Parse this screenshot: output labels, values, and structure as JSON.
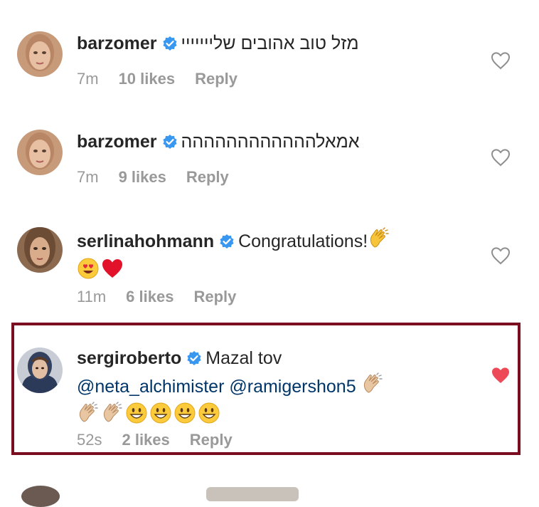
{
  "comments": [
    {
      "username": "barzomer",
      "verified": true,
      "text": "מזל טוב אהובים שלייייייי",
      "time": "7m",
      "likes": "10 likes",
      "reply": "Reply",
      "liked": false
    },
    {
      "username": "barzomer",
      "verified": true,
      "text": "אמאלהההההההההההה",
      "time": "7m",
      "likes": "9 likes",
      "reply": "Reply",
      "liked": false
    },
    {
      "username": "serlinahohmann",
      "verified": true,
      "text": "Congratulations!",
      "emojis": [
        "clapping-hands",
        "heart-eyes-face",
        "red-heart"
      ],
      "time": "11m",
      "likes": "6 likes",
      "reply": "Reply",
      "liked": false
    },
    {
      "username": "sergiroberto",
      "verified": true,
      "text": "Mazal tov",
      "mentions": [
        "@neta_alchimister",
        "@ramigershon5"
      ],
      "emojis": [
        "clapping-hands",
        "clapping-hands",
        "clapping-hands",
        "grinning-face",
        "grinning-face",
        "grinning-face",
        "grinning-face"
      ],
      "time": "52s",
      "likes": "2 likes",
      "reply": "Reply",
      "liked": true,
      "highlighted": true
    }
  ],
  "colors": {
    "highlight_border": "#7a0d1f",
    "liked_heart": "#ed4956",
    "verified_badge": "#3897f0",
    "meta_text": "#999999",
    "mention": "#003569"
  }
}
